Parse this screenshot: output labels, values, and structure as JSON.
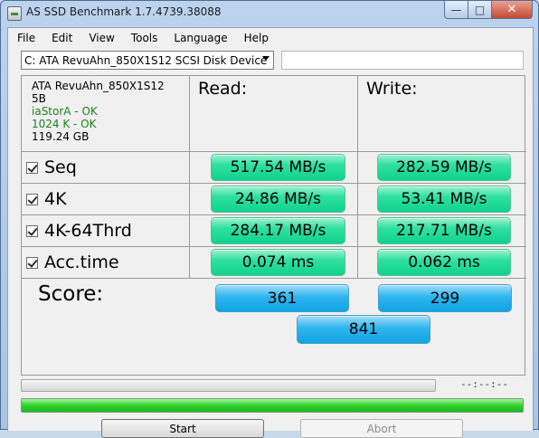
{
  "window": {
    "title": "AS SSD Benchmark 1.7.4739.38088",
    "minimize": "—",
    "maximize": "□",
    "close": "✕"
  },
  "menu": [
    "File",
    "Edit",
    "View",
    "Tools",
    "Language",
    "Help"
  ],
  "drive": {
    "selected": "C: ATA RevuAhn_850X1S12 SCSI Disk Device",
    "search_text": ""
  },
  "info": {
    "model": "ATA RevuAhn_850X1S12",
    "firmware": "5B",
    "driver_status": "iaStorA - OK",
    "alignment_status": "1024 K - OK",
    "capacity": "119.24 GB"
  },
  "headers": {
    "read": "Read:",
    "write": "Write:"
  },
  "tests": [
    {
      "label": "Seq",
      "checked": true,
      "read": "517.54 MB/s",
      "write": "282.59 MB/s"
    },
    {
      "label": "4K",
      "checked": true,
      "read": "24.86 MB/s",
      "write": "53.41 MB/s"
    },
    {
      "label": "4K-64Thrd",
      "checked": true,
      "read": "284.17 MB/s",
      "write": "217.71 MB/s"
    },
    {
      "label": "Acc.time",
      "checked": true,
      "read": "0.074 ms",
      "write": "0.062 ms"
    }
  ],
  "score": {
    "label": "Score:",
    "read": "361",
    "write": "299",
    "total": "841"
  },
  "progress": {
    "time": "--:--:--",
    "overall_fraction": 1.0,
    "current_fraction": 0.0
  },
  "buttons": {
    "start": "Start",
    "abort": "Abort"
  },
  "colors": {
    "result_green": "#10d28d",
    "score_blue": "#11a3e3",
    "progress_green": "#2ccf2a",
    "ok_text": "#1d7f1d"
  }
}
